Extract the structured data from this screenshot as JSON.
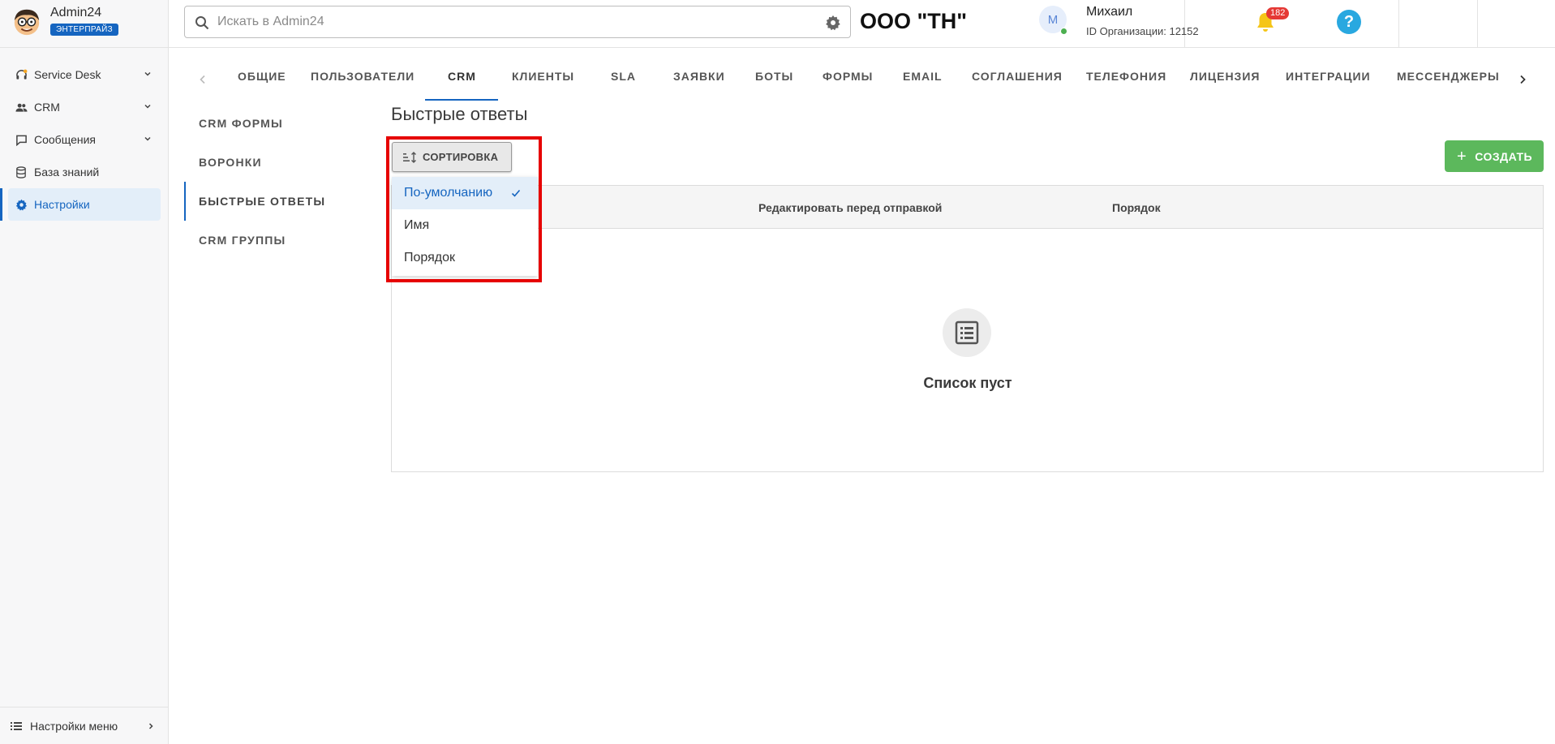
{
  "brand": {
    "name": "Admin24",
    "plan": "ЭНТЕРПРАЙЗ"
  },
  "sidebar": {
    "items": [
      {
        "label": "Service Desk",
        "icon": "headset-icon",
        "expandable": true
      },
      {
        "label": "CRM",
        "icon": "people-icon",
        "expandable": true
      },
      {
        "label": "Сообщения",
        "icon": "chat-icon",
        "expandable": true
      },
      {
        "label": "База знаний",
        "icon": "database-icon",
        "expandable": false
      },
      {
        "label": "Настройки",
        "icon": "gear-icon",
        "expandable": false,
        "active": true
      }
    ],
    "bottom_label": "Настройки меню"
  },
  "header": {
    "search_placeholder": "Искать в Admin24",
    "org_title": "ООО \"ТН\"",
    "user_initial": "М",
    "user_name": "Михаил",
    "user_org": "ID Организации: 12152",
    "notifications_count": "182"
  },
  "tabs": [
    "ОБЩИЕ",
    "ПОЛЬЗОВАТЕЛИ",
    "CRM",
    "КЛИЕНТЫ",
    "SLA",
    "ЗАЯВКИ",
    "БОТЫ",
    "ФОРМЫ",
    "EMAIL",
    "СОГЛАШЕНИЯ",
    "ТЕЛЕФОНИЯ",
    "ЛИЦЕНЗИЯ",
    "ИНТЕГРАЦИИ",
    "МЕССЕНДЖЕРЫ"
  ],
  "active_tab": "CRM",
  "subnav": [
    "CRM ФОРМЫ",
    "ВОРОНКИ",
    "БЫСТРЫЕ ОТВЕТЫ",
    "CRM ГРУППЫ"
  ],
  "active_subnav": "БЫСТРЫЕ ОТВЕТЫ",
  "main": {
    "title": "Быстрые ответы",
    "sort_label": "СОРТИРОВКА",
    "create_label": "СОЗДАТЬ",
    "columns": [
      "Редактировать перед отправкой",
      "Порядок"
    ],
    "empty_text": "Список пуст"
  },
  "sort_menu": {
    "options": [
      "По-умолчанию",
      "Имя",
      "Порядок"
    ],
    "selected": "По-умолчанию"
  },
  "colors": {
    "accent": "#1565c0",
    "create": "#5cb85c",
    "highlight": "#e60000",
    "notif": "#e53935"
  }
}
